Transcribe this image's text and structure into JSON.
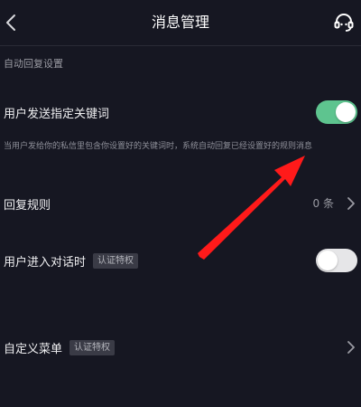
{
  "header": {
    "title": "消息管理",
    "back_icon": "chevron-left-icon",
    "support_icon": "headset-icon"
  },
  "auto_reply": {
    "section_label": "自动回复设置",
    "keyword_row": {
      "label": "用户发送指定关键词",
      "enabled": true,
      "description": "当用户发给你的私信里包含你设置好的关键词时，系统自动回复已经设置好的规则消息"
    },
    "rules_row": {
      "label": "回复规则",
      "count": "0 条"
    },
    "enter_chat_row": {
      "label": "用户进入对话时",
      "badge": "认证特权",
      "enabled": false
    }
  },
  "custom_menu_row": {
    "label": "自定义菜单",
    "badge": "认证特权"
  },
  "colors": {
    "background": "#161722",
    "toggle_on": "#5ec48f",
    "toggle_off": "#e6e6e8",
    "annotation_arrow": "#ff1a1a"
  }
}
